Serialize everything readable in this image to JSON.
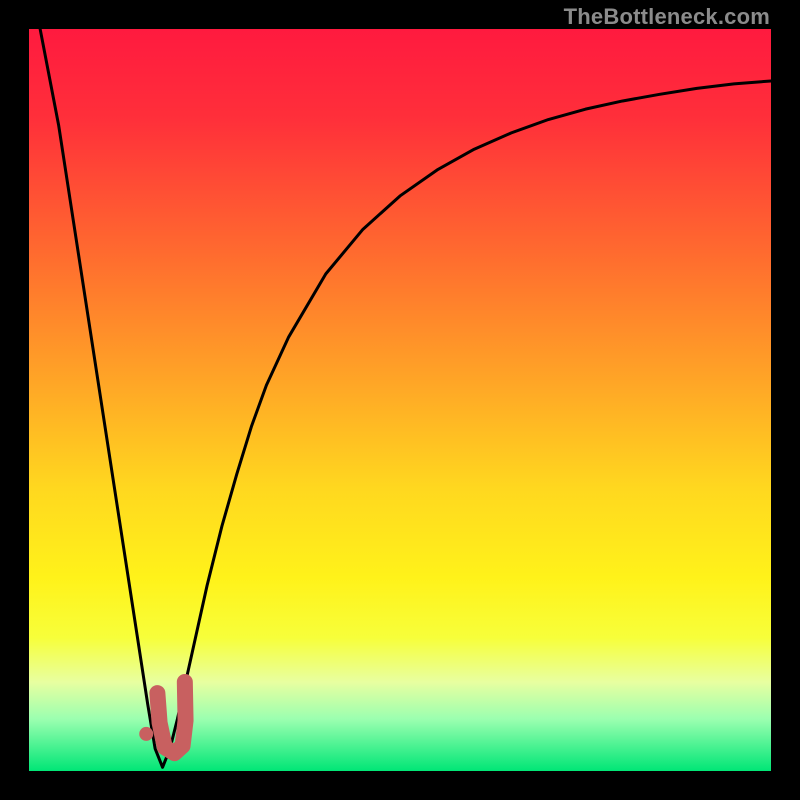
{
  "watermark": "TheBottleneck.com",
  "chart_data": {
    "type": "line",
    "title": "",
    "xlabel": "",
    "ylabel": "",
    "xlim": [
      0,
      100
    ],
    "ylim": [
      0,
      100
    ],
    "gradient_stops": [
      {
        "offset": 0.0,
        "color": "#ff1a3f"
      },
      {
        "offset": 0.12,
        "color": "#ff2f3a"
      },
      {
        "offset": 0.3,
        "color": "#ff6a2f"
      },
      {
        "offset": 0.48,
        "color": "#ffa726"
      },
      {
        "offset": 0.62,
        "color": "#ffd81f"
      },
      {
        "offset": 0.74,
        "color": "#fff21a"
      },
      {
        "offset": 0.82,
        "color": "#f7ff3a"
      },
      {
        "offset": 0.88,
        "color": "#e8ffa0"
      },
      {
        "offset": 0.93,
        "color": "#9bffb0"
      },
      {
        "offset": 1.0,
        "color": "#00e676"
      }
    ],
    "series": [
      {
        "name": "bottleneck-curve",
        "stroke": "#000000",
        "stroke_width": 3,
        "x": [
          1.5,
          4,
          6,
          8,
          10,
          12,
          14,
          16,
          17,
          18,
          19,
          20,
          22,
          24,
          26,
          28,
          30,
          32,
          35,
          40,
          45,
          50,
          55,
          60,
          65,
          70,
          75,
          80,
          85,
          90,
          95,
          100
        ],
        "y": [
          100,
          87,
          74,
          61,
          48,
          35,
          22,
          9,
          3,
          0.5,
          3,
          7,
          16,
          25,
          33,
          40,
          46.5,
          52,
          58.5,
          67,
          73,
          77.5,
          81,
          83.8,
          86,
          87.8,
          89.2,
          90.3,
          91.2,
          92,
          92.6,
          93
        ]
      }
    ],
    "minimum_marker": {
      "color": "#c86060",
      "dot": {
        "x": 15.8,
        "y": 5.0,
        "r": 7
      },
      "hook_path": [
        {
          "x": 17.3,
          "y": 10.5
        },
        {
          "x": 17.6,
          "y": 6.5
        },
        {
          "x": 18.3,
          "y": 3.2
        },
        {
          "x": 19.6,
          "y": 2.4
        },
        {
          "x": 20.7,
          "y": 3.4
        },
        {
          "x": 21.1,
          "y": 6.8
        },
        {
          "x": 21.0,
          "y": 12.0
        }
      ],
      "hook_width": 16
    }
  }
}
